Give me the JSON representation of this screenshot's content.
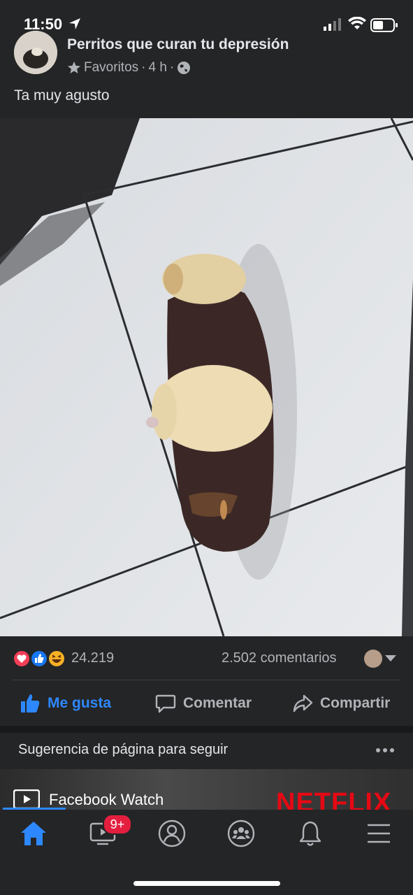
{
  "status_bar": {
    "time": "11:50"
  },
  "post": {
    "page_name": "Perritos que curan tu depresión",
    "audience_label": "Favoritos",
    "time_ago": "4 h",
    "meta_separator": "·",
    "text": "Ta muy agusto"
  },
  "reactions": {
    "count": "24.219",
    "comments": "2.502 comentarios",
    "types": [
      "love",
      "like",
      "haha"
    ]
  },
  "actions": {
    "like": "Me gusta",
    "comment": "Comentar",
    "share": "Compartir"
  },
  "suggestion": {
    "title": "Sugerencia de página para seguir",
    "page_label": "Facebook Watch",
    "preview_text": "NETFLIX"
  },
  "tabbar": {
    "items": [
      "home-icon",
      "watch-icon",
      "profile-icon",
      "groups-icon",
      "notifications-icon",
      "menu-icon"
    ],
    "watch_badge": "9+"
  },
  "colors": {
    "accent": "#2d88ff",
    "badge": "#e41e3f",
    "background": "#242526",
    "secondary_text": "#b0b3b8"
  }
}
